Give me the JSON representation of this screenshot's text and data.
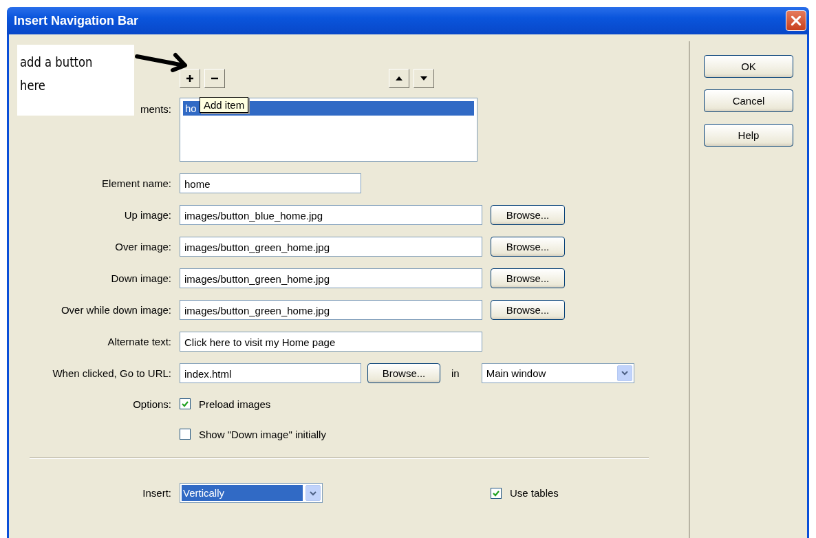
{
  "window": {
    "title": "Insert Navigation Bar"
  },
  "annotation": {
    "lines": [
      "add a button",
      "here"
    ]
  },
  "toolbar": [
    {
      "kind": "add"
    },
    {
      "kind": "remove"
    },
    {
      "kind": "up"
    },
    {
      "kind": "down"
    }
  ],
  "elements_list": {
    "label": "ments:",
    "items": [
      {
        "text": "ho",
        "selected": true
      }
    ]
  },
  "tooltip": "Add item",
  "fields": [
    {
      "kind": "name",
      "label": "Element name:",
      "value": "home"
    },
    {
      "kind": "image",
      "label": "Up image:",
      "value": "images/button_blue_home.jpg",
      "browse": "Browse..."
    },
    {
      "kind": "image",
      "label": "Over image:",
      "value": "images/button_green_home.jpg",
      "browse": "Browse..."
    },
    {
      "kind": "image",
      "label": "Down image:",
      "value": "images/button_green_home.jpg",
      "browse": "Browse..."
    },
    {
      "kind": "image",
      "label": "Over while down image:",
      "value": "images/button_green_home.jpg",
      "browse": "Browse..."
    },
    {
      "kind": "text",
      "label": "Alternate text:",
      "value": "Click here to visit my Home page"
    }
  ],
  "url": {
    "label": "When clicked, Go to URL:",
    "value": "index.html",
    "browse": "Browse...",
    "in_label": "in",
    "target": "Main window"
  },
  "options": {
    "label": "Options:",
    "checks": [
      {
        "label": "Preload images",
        "checked": true
      },
      {
        "label": "Show \"Down image\" initially",
        "checked": false
      }
    ]
  },
  "insert": {
    "label": "Insert:",
    "value": "Vertically"
  },
  "use_tables": {
    "label": "Use tables",
    "checked": true
  },
  "buttons": [
    "OK",
    "Cancel",
    "Help"
  ]
}
